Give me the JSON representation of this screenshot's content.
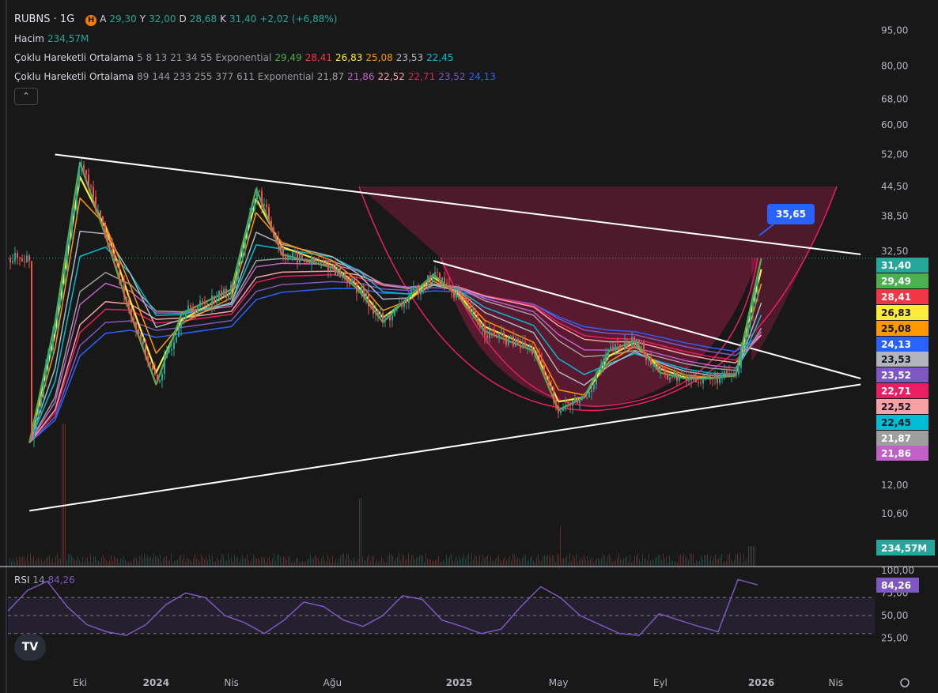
{
  "header": {
    "ticker": "RUBNS · 1G",
    "badge": "H",
    "ohlc": {
      "o_lbl": "A",
      "o": "29,30",
      "h_lbl": "Y",
      "h": "32,00",
      "l_lbl": "D",
      "l": "28,68",
      "c_lbl": "K",
      "c": "31,40",
      "chg": "+2,02 (+6,88%)"
    },
    "volume": {
      "label": "Hacim",
      "value": "234,57M"
    },
    "ma1": {
      "label": "Çoklu Hareketli Ortalama",
      "params": "5 8 13 21 34 55 Exponential",
      "values": [
        "29,49",
        "28,41",
        "26,83",
        "25,08",
        "23,53",
        "22,45"
      ]
    },
    "ma2": {
      "label": "Çoklu Hareketli Ortalama",
      "params": "89 144 233 255 377 611 Exponential",
      "values": [
        "21,87",
        "21,86",
        "22,52",
        "22,71",
        "23,52",
        "24,13"
      ]
    },
    "collapse_icon": "chevron-up-icon"
  },
  "colors": {
    "bg": "#181818",
    "up": "#26a69a",
    "down": "#ef5350",
    "ema5": "#4caf50",
    "ema8": "#f23645",
    "ema13": "#ffeb3b",
    "ema21": "#ff9800",
    "ema34": "#b2b5be",
    "ema55": "#00bcd4",
    "ema89": "#9e9e9e",
    "ema144": "#c060c8",
    "ema233": "#f7a1a5",
    "ema255": "#e91e63",
    "ema377": "#7e57c2",
    "ema611": "#2962ff",
    "rsi": "#7e57c2"
  },
  "chart_data": {
    "type": "line",
    "title": "RUBNS · 1G",
    "y_scale": "log",
    "y_ticks": [
      "95,00",
      "80,00",
      "68,00",
      "60,00",
      "52,00",
      "44,50",
      "38,50",
      "32,50",
      "12,00",
      "10,60"
    ],
    "x_ticks": [
      "Eki",
      "2024",
      "Nis",
      "Ağu",
      "2025",
      "May",
      "Eyl",
      "2026",
      "Nis"
    ],
    "last_price": "31,40",
    "price_path": [
      [
        "2023-08",
        12.8
      ],
      [
        "2023-09",
        23
      ],
      [
        "2023-10",
        50
      ],
      [
        "2023-11",
        35
      ],
      [
        "2023-12",
        24
      ],
      [
        "2024-01",
        17
      ],
      [
        "2024-02",
        24
      ],
      [
        "2024-04",
        27
      ],
      [
        "2024-05",
        44
      ],
      [
        "2024-06",
        32
      ],
      [
        "2024-08",
        30
      ],
      [
        "2024-09",
        27
      ],
      [
        "2024-10",
        23
      ],
      [
        "2024-11",
        26
      ],
      [
        "2024-12",
        29
      ],
      [
        "2025-01",
        26
      ],
      [
        "2025-02",
        22
      ],
      [
        "2025-04",
        20
      ],
      [
        "2025-05",
        15
      ],
      [
        "2025-06",
        16
      ],
      [
        "2025-07",
        20
      ],
      [
        "2025-08",
        21
      ],
      [
        "2025-09",
        18
      ],
      [
        "2025-10",
        17.5
      ],
      [
        "2025-11",
        17.5
      ],
      [
        "2025-12",
        17.8
      ],
      [
        "2026-01",
        31.4
      ]
    ],
    "trendlines": [
      {
        "name": "upper-resistance",
        "from": [
          "2023-09",
          52
        ],
        "to": [
          "2026-05",
          32
        ]
      },
      {
        "name": "lower-support",
        "from": [
          "2023-08",
          9.2
        ],
        "to": [
          "2026-05",
          17
        ]
      },
      {
        "name": "inner-resistance",
        "from": [
          "2024-12",
          31
        ],
        "to": [
          "2026-05",
          17.5
        ]
      }
    ],
    "pattern": {
      "type": "cup-and-handle",
      "target_label": "35,65",
      "range_top": 44.5,
      "range_bottom": 31.5
    },
    "price_badges": [
      {
        "text": "31,40",
        "color": "#26a69a"
      },
      {
        "text": "29,49",
        "color": "#4caf50"
      },
      {
        "text": "28,41",
        "color": "#f23645"
      },
      {
        "text": "26,83",
        "color": "#ffeb3b"
      },
      {
        "text": "25,08",
        "color": "#ff9800"
      },
      {
        "text": "24,13",
        "color": "#2962ff"
      },
      {
        "text": "23,53",
        "color": "#b2b5be"
      },
      {
        "text": "23,52",
        "color": "#7e57c2"
      },
      {
        "text": "22,71",
        "color": "#e91e63"
      },
      {
        "text": "22,52",
        "color": "#f7a1a5"
      },
      {
        "text": "22,45",
        "color": "#00bcd4"
      },
      {
        "text": "21,87",
        "color": "#9e9e9e"
      },
      {
        "text": "21,86",
        "color": "#c060c8"
      }
    ],
    "volume_badge": "234,57M",
    "rsi": {
      "label": "RSI",
      "period": "14",
      "value": "84,26",
      "ylim": [
        0,
        100
      ],
      "y_ticks": [
        "100,00",
        "75,00",
        "50,00",
        "25,00"
      ],
      "bands": [
        30,
        70
      ],
      "path": [
        55,
        78,
        88,
        60,
        40,
        32,
        28,
        40,
        62,
        75,
        70,
        50,
        42,
        30,
        45,
        65,
        60,
        45,
        38,
        50,
        72,
        68,
        45,
        38,
        30,
        35,
        60,
        82,
        70,
        50,
        40,
        30,
        28,
        52,
        45,
        38,
        32,
        90,
        84
      ]
    }
  }
}
